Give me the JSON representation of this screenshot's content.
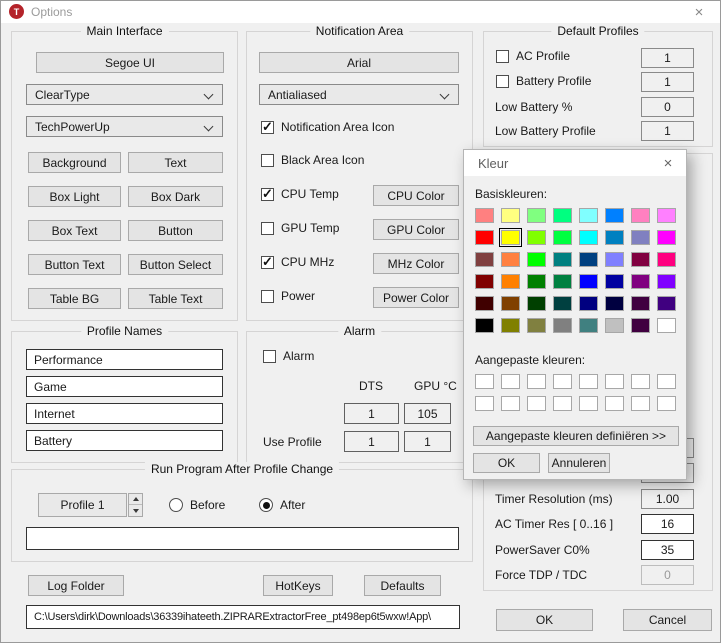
{
  "window": {
    "title": "Options",
    "icon_letter": "T",
    "icon_color": "#b4232a",
    "close_glyph": "×"
  },
  "main_interface": {
    "title": "Main Interface",
    "font_button": "Segoe UI",
    "rendering_dropdown": "ClearType",
    "theme_dropdown": "TechPowerUp",
    "color_buttons": [
      "Background",
      "Text",
      "Box Light",
      "Box Dark",
      "Box Text",
      "Button",
      "Button Text",
      "Button Select",
      "Table BG",
      "Table Text"
    ]
  },
  "profile_names": {
    "title": "Profile Names",
    "profiles": [
      "Performance",
      "Game",
      "Internet",
      "Battery"
    ]
  },
  "notification_area": {
    "title": "Notification Area",
    "font_button": "Arial",
    "smoothing_dropdown": "Antialiased",
    "rows": [
      {
        "label": "Notification Area Icon",
        "checked": true
      },
      {
        "label": "Black Area Icon",
        "checked": false
      },
      {
        "label": "CPU Temp",
        "checked": true,
        "button": "CPU Color"
      },
      {
        "label": "GPU Temp",
        "checked": false,
        "button": "GPU Color"
      },
      {
        "label": "CPU MHz",
        "checked": true,
        "button": "MHz Color"
      },
      {
        "label": "Power",
        "checked": false,
        "button": "Power Color"
      }
    ]
  },
  "alarm": {
    "title": "Alarm",
    "checkbox_label": "Alarm",
    "checked": false,
    "dts_header": "DTS",
    "gpu_header": "GPU °C",
    "dts_value": "1",
    "gpu_value": "105",
    "use_profile_label": "Use Profile",
    "use_profile_dts": "1",
    "use_profile_gpu": "1"
  },
  "run_program": {
    "title": "Run Program After Profile Change",
    "profile_selector": "Profile 1",
    "before_label": "Before",
    "before_checked": false,
    "after_label": "After",
    "after_checked": true,
    "command_value": ""
  },
  "bottom": {
    "log_folder": "Log Folder",
    "hotkeys": "HotKeys",
    "defaults": "Defaults",
    "log_path": "C:\\Users\\dirk\\Downloads\\36339ihateeth.ZIPRARExtractorFree_pt498ep6t5wxw!App\\"
  },
  "default_profiles": {
    "title": "Default Profiles",
    "ac_label": "AC Profile",
    "ac_checked": false,
    "ac_value": "1",
    "battery_label": "Battery Profile",
    "battery_checked": false,
    "battery_value": "1",
    "low_battery_label": "Low Battery %",
    "low_battery_value": "0",
    "low_battery_profile_label": "Low Battery Profile",
    "low_battery_profile_value": "1"
  },
  "right_settings": {
    "timer_resolution_label": "Timer Resolution (ms)",
    "timer_resolution_value": "1.00",
    "ac_timer_label": "AC Timer Res [ 0..16 ]",
    "ac_timer_value": "16",
    "powersaver_label": "PowerSaver C0%",
    "powersaver_value": "35",
    "force_tdp_label": "Force TDP / TDC",
    "force_tdp_value": "0",
    "ok": "OK",
    "cancel": "Cancel"
  },
  "color_dialog": {
    "title": "Kleur",
    "close_glyph": "×",
    "basic_label": "Basiskleuren:",
    "custom_label": "Aangepaste kleuren:",
    "define_button": "Aangepaste kleuren definiëren >>",
    "ok": "OK",
    "cancel": "Annuleren",
    "selected_index": 9,
    "custom_color": "#FFFFFF",
    "basic_colors": [
      "#FF8080",
      "#FFFF80",
      "#80FF80",
      "#00FF80",
      "#80FFFF",
      "#0080FF",
      "#FF80C0",
      "#FF80FF",
      "#FF0000",
      "#FFFF00",
      "#80FF00",
      "#00FF40",
      "#00FFFF",
      "#0080C0",
      "#8080C0",
      "#FF00FF",
      "#804040",
      "#FF8040",
      "#00FF00",
      "#008080",
      "#004080",
      "#8080FF",
      "#800040",
      "#FF0080",
      "#800000",
      "#FF8000",
      "#008000",
      "#008040",
      "#0000FF",
      "#0000A0",
      "#800080",
      "#8000FF",
      "#400000",
      "#804000",
      "#004000",
      "#004040",
      "#000080",
      "#000040",
      "#400040",
      "#400080",
      "#000000",
      "#808000",
      "#808040",
      "#808080",
      "#408080",
      "#C0C0C0",
      "#400040",
      "#FFFFFF"
    ]
  }
}
